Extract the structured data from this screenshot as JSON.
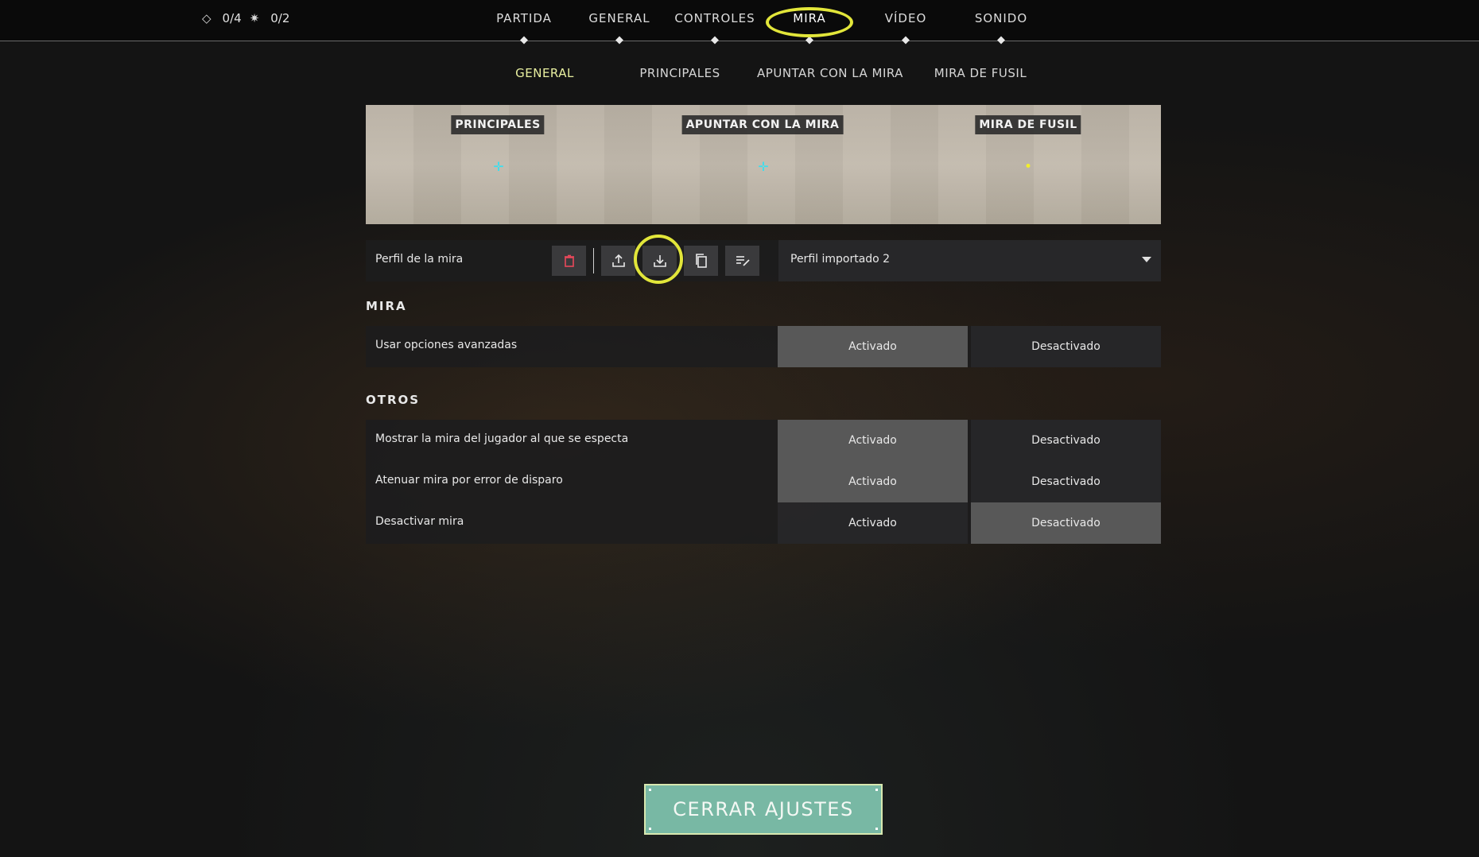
{
  "hud": {
    "counter_a": "0/4",
    "counter_b": "0/2",
    "icon_a": "diamond-icon",
    "icon_b": "sun-icon"
  },
  "nav": {
    "tabs": [
      {
        "label": "PARTIDA"
      },
      {
        "label": "GENERAL"
      },
      {
        "label": "CONTROLES"
      },
      {
        "label": "MIRA"
      },
      {
        "label": "VÍDEO"
      },
      {
        "label": "SONIDO"
      }
    ],
    "active": "MIRA"
  },
  "subnav": {
    "tabs": [
      {
        "label": "GENERAL"
      },
      {
        "label": "PRINCIPALES"
      },
      {
        "label": "APUNTAR CON LA MIRA"
      },
      {
        "label": "MIRA DE FUSIL"
      }
    ],
    "active": "GENERAL"
  },
  "preview": {
    "labels": [
      "PRINCIPALES",
      "APUNTAR CON LA MIRA",
      "MIRA DE FUSIL"
    ],
    "crosshair_color": "#38e0f0",
    "sniper_dot_color": "#f2ee2a"
  },
  "profile": {
    "label": "Perfil de la mira",
    "icons": [
      "trash-icon",
      "upload-icon",
      "download-icon",
      "copy-icon",
      "rename-icon"
    ],
    "selected": "Perfil importado 2"
  },
  "sections": {
    "mira": "MIRA",
    "otros": "OTROS"
  },
  "options": {
    "on": "Activado",
    "off": "Desactivado"
  },
  "settings": [
    {
      "label": "Usar opciones avanzadas",
      "value": "Activado"
    },
    {
      "label": "Mostrar la mira del jugador al que se especta",
      "value": "Activado"
    },
    {
      "label": "Atenuar mira por error de disparo",
      "value": "Activado"
    },
    {
      "label": "Desactivar mira",
      "value": "Desactivado"
    }
  ],
  "close_button": "CERRAR AJUSTES",
  "colors": {
    "highlight": "#e2e63a",
    "accent": "#78b8a4"
  }
}
